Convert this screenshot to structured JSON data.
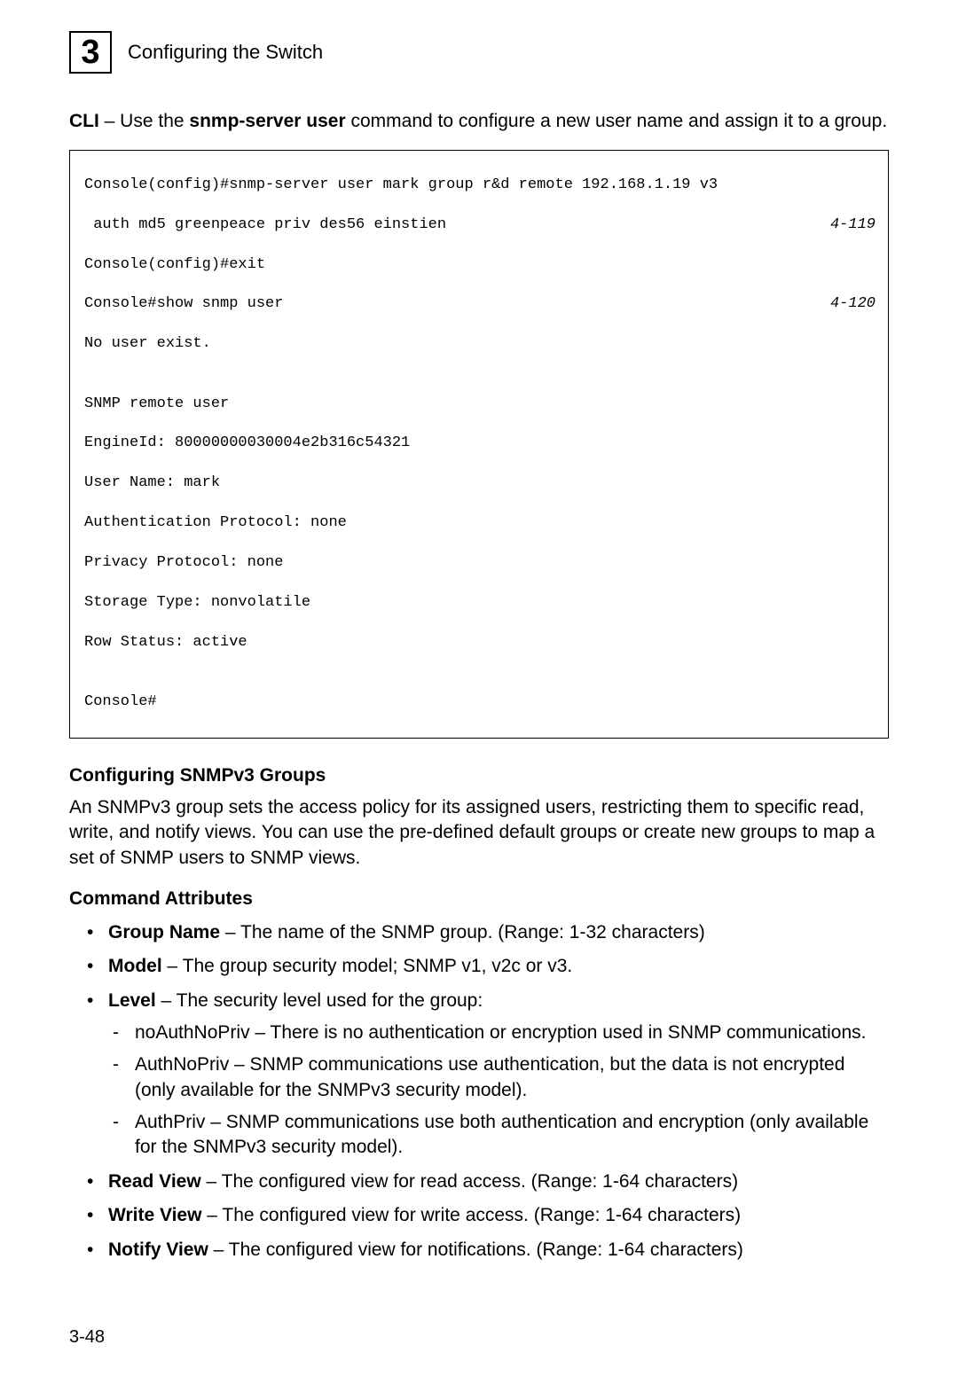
{
  "header": {
    "chapter_number": "3",
    "section_title": "Configuring the Switch"
  },
  "intro": {
    "cli_label": "CLI",
    "dash": " – Use the ",
    "command": "snmp-server user",
    "rest": " command to configure a new user name and assign it to a group."
  },
  "code": {
    "line1_left": "Console(config)#snmp-server user mark group r&d remote 192.168.1.19 v3 ",
    "line2_left": " auth md5 greenpeace priv des56 einstien",
    "line2_ref": "4-119",
    "line3": "Console(config)#exit",
    "line4_left": "Console#show snmp user",
    "line4_ref": "4-120",
    "line5": "No user exist.",
    "blank": "",
    "line6": "SNMP remote user",
    "line7": "EngineId: 80000000030004e2b316c54321",
    "line8": "User Name: mark",
    "line9": "Authentication Protocol: none",
    "line10": "Privacy Protocol: none",
    "line11": "Storage Type: nonvolatile",
    "line12": "Row Status: active",
    "line13": "Console#"
  },
  "section": {
    "heading": "Configuring SNMPv3 Groups",
    "paragraph": "An SNMPv3 group sets the access policy for its assigned users, restricting them to specific read, write, and notify views. You can use the pre-defined default groups or create new groups to map a set of SNMP users to SNMP views."
  },
  "attrs": {
    "heading": "Command Attributes",
    "items": [
      {
        "bold": "Group Name",
        "text": " – The name of the SNMP group. (Range: 1-32 characters)"
      },
      {
        "bold": "Model",
        "text": " – The group security model; SNMP v1, v2c or v3."
      },
      {
        "bold": "Level",
        "text": " – The security level used for the group:",
        "sub": [
          "noAuthNoPriv – There is no authentication or encryption used in SNMP communications.",
          "AuthNoPriv – SNMP communications use authentication, but the data is not encrypted (only available for the SNMPv3 security model).",
          "AuthPriv – SNMP communications use both authentication and encryption (only available for the SNMPv3 security model)."
        ]
      },
      {
        "bold": "Read View",
        "text": " – The configured view for read access. (Range: 1-64 characters)"
      },
      {
        "bold": "Write View",
        "text": " – The configured view for write access. (Range: 1-64 characters)"
      },
      {
        "bold": "Notify View",
        "text": " – The configured view for notifications. (Range: 1-64 characters)"
      }
    ]
  },
  "page_number": "3-48"
}
